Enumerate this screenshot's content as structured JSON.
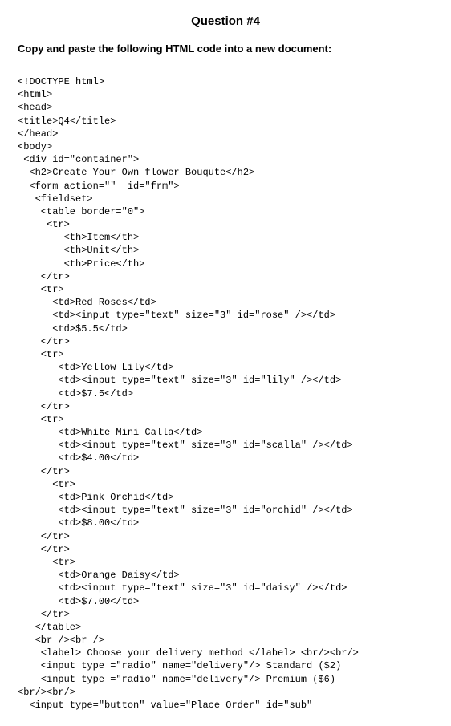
{
  "title": "Question #4",
  "instruction": "Copy and paste the following HTML code into a new document:",
  "code": "<!DOCTYPE html>\n<html>\n<head>\n<title>Q4</title>\n</head>\n<body>\n <div id=\"container\">\n  <h2>Create Your Own flower Bouqute</h2>\n  <form action=\"\"  id=\"frm\">\n   <fieldset>\n    <table border=\"0\">\n     <tr>\n        <th>Item</th>\n        <th>Unit</th>\n        <th>Price</th>\n    </tr>\n    <tr>\n      <td>Red Roses</td>\n      <td><input type=\"text\" size=\"3\" id=\"rose\" /></td>\n      <td>$5.5</td>\n    </tr>\n    <tr>\n       <td>Yellow Lily</td>\n       <td><input type=\"text\" size=\"3\" id=\"lily\" /></td>\n       <td>$7.5</td>\n    </tr>\n    <tr>\n       <td>White Mini Calla</td>\n       <td><input type=\"text\" size=\"3\" id=\"scalla\" /></td>\n       <td>$4.00</td>\n    </tr>\n      <tr>\n       <td>Pink Orchid</td>\n       <td><input type=\"text\" size=\"3\" id=\"orchid\" /></td>\n       <td>$8.00</td>\n    </tr>\n    </tr>\n      <tr>\n       <td>Orange Daisy</td>\n       <td><input type=\"text\" size=\"3\" id=\"daisy\" /></td>\n       <td>$7.00</td>\n    </tr>\n   </table>\n   <br /><br />\n    <label> Choose your delivery method </label> <br/><br/>\n    <input type =\"radio\" name=\"delivery\"/> Standard ($2)\n    <input type =\"radio\" name=\"delivery\"/> Premium ($6)\n<br/><br/>\n  <input type=\"button\" value=\"Place Order\" id=\"sub\""
}
